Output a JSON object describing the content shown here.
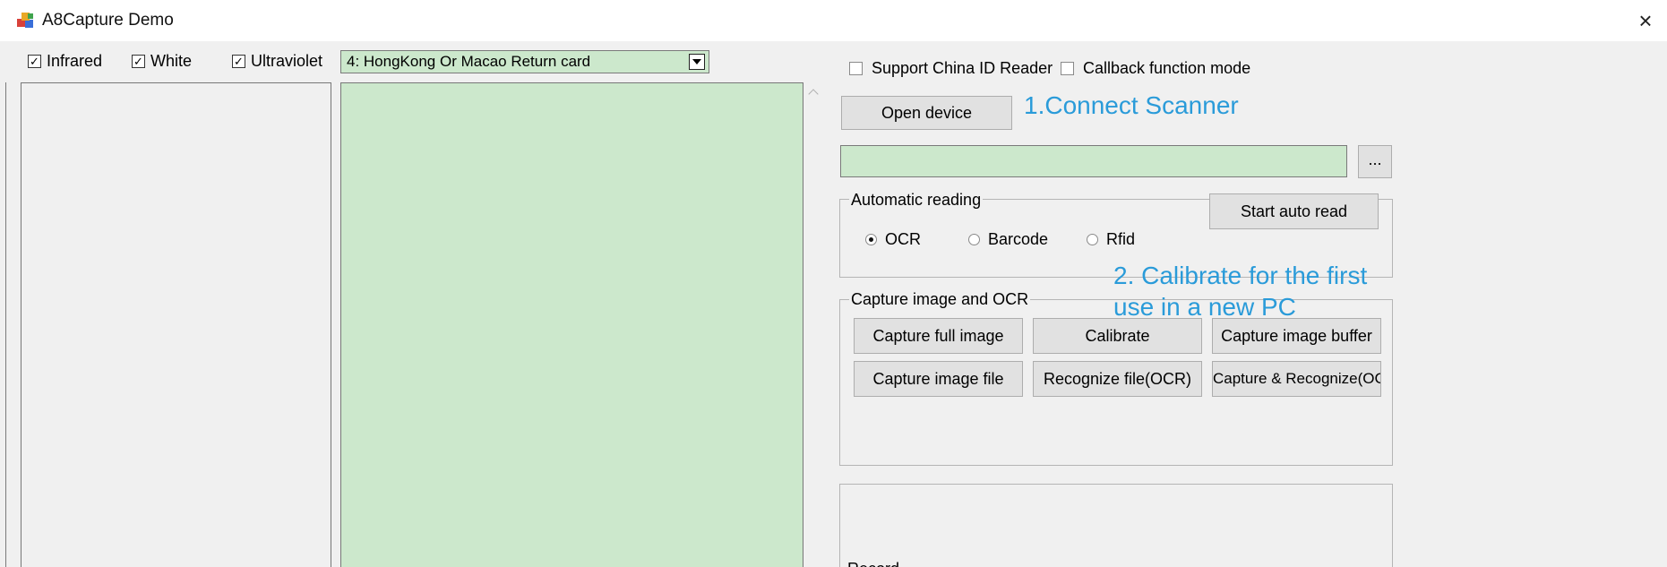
{
  "window": {
    "title": "A8Capture Demo",
    "close_glyph": "×"
  },
  "light_options": [
    {
      "label": "Infrared",
      "checked": true
    },
    {
      "label": "White",
      "checked": true
    },
    {
      "label": "Ultraviolet",
      "checked": true
    }
  ],
  "card_type": {
    "selected": "4: HongKong Or Macao Return card"
  },
  "options": {
    "support_china_id": {
      "label": "Support China ID Reader",
      "checked": false
    },
    "callback_mode": {
      "label": "Callback function mode",
      "checked": false
    }
  },
  "buttons": {
    "open_device": "Open device",
    "browse": "...",
    "start_auto_read": "Start auto read",
    "capture_full_image": "Capture full image",
    "calibrate": "Calibrate",
    "capture_image_buffer": "Capture image buffer",
    "capture_image_file": "Capture image file",
    "recognize_file": "Recognize file(OCR)",
    "capture_recognize": "Capture & Recognize(OCR)"
  },
  "annotations": {
    "step1": "1.Connect Scanner",
    "step2_line1": "2. Calibrate for the first",
    "step2_line2": "use in a new PC"
  },
  "automatic_reading": {
    "title": "Automatic reading",
    "modes": [
      {
        "label": "OCR",
        "selected": true
      },
      {
        "label": "Barcode",
        "selected": false
      },
      {
        "label": "Rfid",
        "selected": false
      }
    ]
  },
  "capture_group": {
    "title": "Capture image and OCR"
  },
  "bottom_group": {
    "title": "Record"
  },
  "colors": {
    "field_green": "#cce8cc",
    "annotation_blue": "#2a9bd9",
    "background": "#f0f0f0"
  }
}
